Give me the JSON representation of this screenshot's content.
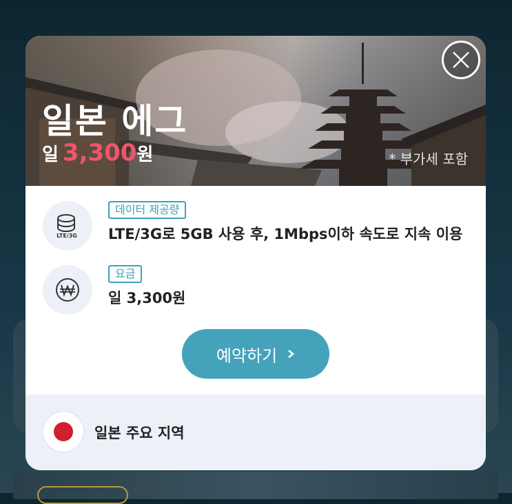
{
  "modal": {
    "title": "일본 에그",
    "price_prefix": "일",
    "price_value": "3,300",
    "price_suffix": "원",
    "vat_note": "* 부가세 포함"
  },
  "details": [
    {
      "icon": "data-lte-3g-icon",
      "icon_label": "LTE/3G",
      "tag": "데이터 제공량",
      "text": "LTE/3G로 5GB 사용 후, 1Mbps이하 속도로 지속 이용"
    },
    {
      "icon": "won-currency-icon",
      "tag": "요금",
      "text": "일 3,300원"
    }
  ],
  "reserve_button": {
    "label": "예약하기"
  },
  "region": {
    "icon": "japan-flag-icon",
    "label": "일본 주요 지역"
  },
  "colors": {
    "accent": "#44a3ba",
    "price": "#f0556a",
    "tag": "#3aa3b8"
  }
}
